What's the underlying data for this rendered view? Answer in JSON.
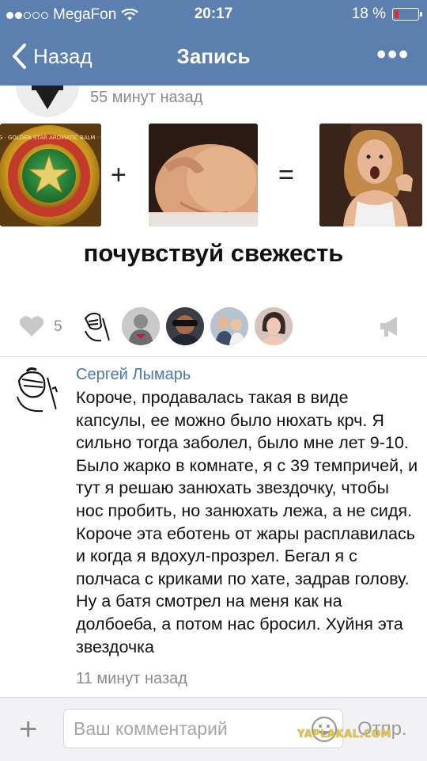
{
  "status_bar": {
    "carrier": "MegaFon",
    "time": "20:17",
    "battery": "18 %",
    "battery_level": 0.18,
    "signal_bars_filled": 2,
    "signal_bars_total": 5
  },
  "nav": {
    "back_label": "Назад",
    "title": "Запись",
    "more_label": "•••"
  },
  "post": {
    "time": "55 минут назад",
    "image": {
      "balm_text": "CAO SAO VÀNG · GOLDEN STAR AROMATIC BALM · S.X. VIETNAM",
      "plus": "+",
      "equals": "=",
      "caption": "почувствуй свежесть"
    },
    "likes_count": "5"
  },
  "comment": {
    "author": "Сергей Лымарь",
    "text": "Короче, продавалась такая в виде капсулы, ее можно было нюхать крч. Я сильно тогда заболел, было мне лет 9-10. Было жарко в комнате, я с 39 темпричей, и тут я решаю занюхать звездочку, чтобы нос пробить, но занюхать лежа, а не сидя. Короче эта еботень от жары расплавилась и когда я вдохул-прозрел. Бегал я с полчаса с криками по хате, задрав голову. Ну а батя смотрел на меня как на долбоеба, а потом нас бросил. Хуйня эта звездочка",
    "time": "11 минут назад"
  },
  "composer": {
    "plus_label": "+",
    "placeholder": "Ваш комментарий",
    "send_label": "Отпр."
  },
  "watermark": "YAPLAKAL.COM",
  "colors": {
    "header_bg": "#5b7fae",
    "author_link": "#4a77a8",
    "battery_low": "#e7262b"
  }
}
